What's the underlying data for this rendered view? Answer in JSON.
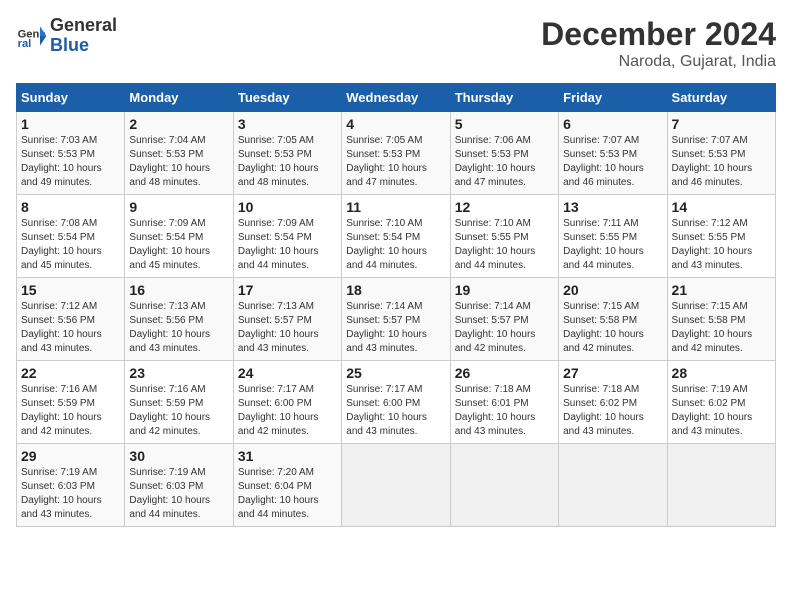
{
  "header": {
    "logo_line1": "General",
    "logo_line2": "Blue",
    "month_title": "December 2024",
    "location": "Naroda, Gujarat, India"
  },
  "calendar": {
    "days_of_week": [
      "Sunday",
      "Monday",
      "Tuesday",
      "Wednesday",
      "Thursday",
      "Friday",
      "Saturday"
    ],
    "weeks": [
      [
        {
          "num": "",
          "info": ""
        },
        {
          "num": "2",
          "info": "Sunrise: 7:04 AM\nSunset: 5:53 PM\nDaylight: 10 hours\nand 48 minutes."
        },
        {
          "num": "3",
          "info": "Sunrise: 7:05 AM\nSunset: 5:53 PM\nDaylight: 10 hours\nand 48 minutes."
        },
        {
          "num": "4",
          "info": "Sunrise: 7:05 AM\nSunset: 5:53 PM\nDaylight: 10 hours\nand 47 minutes."
        },
        {
          "num": "5",
          "info": "Sunrise: 7:06 AM\nSunset: 5:53 PM\nDaylight: 10 hours\nand 47 minutes."
        },
        {
          "num": "6",
          "info": "Sunrise: 7:07 AM\nSunset: 5:53 PM\nDaylight: 10 hours\nand 46 minutes."
        },
        {
          "num": "7",
          "info": "Sunrise: 7:07 AM\nSunset: 5:53 PM\nDaylight: 10 hours\nand 46 minutes."
        }
      ],
      [
        {
          "num": "1",
          "info": "Sunrise: 7:03 AM\nSunset: 5:53 PM\nDaylight: 10 hours\nand 49 minutes."
        },
        {
          "num": "",
          "info": ""
        },
        {
          "num": "",
          "info": ""
        },
        {
          "num": "",
          "info": ""
        },
        {
          "num": "",
          "info": ""
        },
        {
          "num": "",
          "info": ""
        },
        {
          "num": "",
          "info": ""
        }
      ],
      [
        {
          "num": "8",
          "info": "Sunrise: 7:08 AM\nSunset: 5:54 PM\nDaylight: 10 hours\nand 45 minutes."
        },
        {
          "num": "9",
          "info": "Sunrise: 7:09 AM\nSunset: 5:54 PM\nDaylight: 10 hours\nand 45 minutes."
        },
        {
          "num": "10",
          "info": "Sunrise: 7:09 AM\nSunset: 5:54 PM\nDaylight: 10 hours\nand 44 minutes."
        },
        {
          "num": "11",
          "info": "Sunrise: 7:10 AM\nSunset: 5:54 PM\nDaylight: 10 hours\nand 44 minutes."
        },
        {
          "num": "12",
          "info": "Sunrise: 7:10 AM\nSunset: 5:55 PM\nDaylight: 10 hours\nand 44 minutes."
        },
        {
          "num": "13",
          "info": "Sunrise: 7:11 AM\nSunset: 5:55 PM\nDaylight: 10 hours\nand 44 minutes."
        },
        {
          "num": "14",
          "info": "Sunrise: 7:12 AM\nSunset: 5:55 PM\nDaylight: 10 hours\nand 43 minutes."
        }
      ],
      [
        {
          "num": "15",
          "info": "Sunrise: 7:12 AM\nSunset: 5:56 PM\nDaylight: 10 hours\nand 43 minutes."
        },
        {
          "num": "16",
          "info": "Sunrise: 7:13 AM\nSunset: 5:56 PM\nDaylight: 10 hours\nand 43 minutes."
        },
        {
          "num": "17",
          "info": "Sunrise: 7:13 AM\nSunset: 5:57 PM\nDaylight: 10 hours\nand 43 minutes."
        },
        {
          "num": "18",
          "info": "Sunrise: 7:14 AM\nSunset: 5:57 PM\nDaylight: 10 hours\nand 43 minutes."
        },
        {
          "num": "19",
          "info": "Sunrise: 7:14 AM\nSunset: 5:57 PM\nDaylight: 10 hours\nand 42 minutes."
        },
        {
          "num": "20",
          "info": "Sunrise: 7:15 AM\nSunset: 5:58 PM\nDaylight: 10 hours\nand 42 minutes."
        },
        {
          "num": "21",
          "info": "Sunrise: 7:15 AM\nSunset: 5:58 PM\nDaylight: 10 hours\nand 42 minutes."
        }
      ],
      [
        {
          "num": "22",
          "info": "Sunrise: 7:16 AM\nSunset: 5:59 PM\nDaylight: 10 hours\nand 42 minutes."
        },
        {
          "num": "23",
          "info": "Sunrise: 7:16 AM\nSunset: 5:59 PM\nDaylight: 10 hours\nand 42 minutes."
        },
        {
          "num": "24",
          "info": "Sunrise: 7:17 AM\nSunset: 6:00 PM\nDaylight: 10 hours\nand 42 minutes."
        },
        {
          "num": "25",
          "info": "Sunrise: 7:17 AM\nSunset: 6:00 PM\nDaylight: 10 hours\nand 43 minutes."
        },
        {
          "num": "26",
          "info": "Sunrise: 7:18 AM\nSunset: 6:01 PM\nDaylight: 10 hours\nand 43 minutes."
        },
        {
          "num": "27",
          "info": "Sunrise: 7:18 AM\nSunset: 6:02 PM\nDaylight: 10 hours\nand 43 minutes."
        },
        {
          "num": "28",
          "info": "Sunrise: 7:19 AM\nSunset: 6:02 PM\nDaylight: 10 hours\nand 43 minutes."
        }
      ],
      [
        {
          "num": "29",
          "info": "Sunrise: 7:19 AM\nSunset: 6:03 PM\nDaylight: 10 hours\nand 43 minutes."
        },
        {
          "num": "30",
          "info": "Sunrise: 7:19 AM\nSunset: 6:03 PM\nDaylight: 10 hours\nand 44 minutes."
        },
        {
          "num": "31",
          "info": "Sunrise: 7:20 AM\nSunset: 6:04 PM\nDaylight: 10 hours\nand 44 minutes."
        },
        {
          "num": "",
          "info": ""
        },
        {
          "num": "",
          "info": ""
        },
        {
          "num": "",
          "info": ""
        },
        {
          "num": "",
          "info": ""
        }
      ]
    ]
  }
}
